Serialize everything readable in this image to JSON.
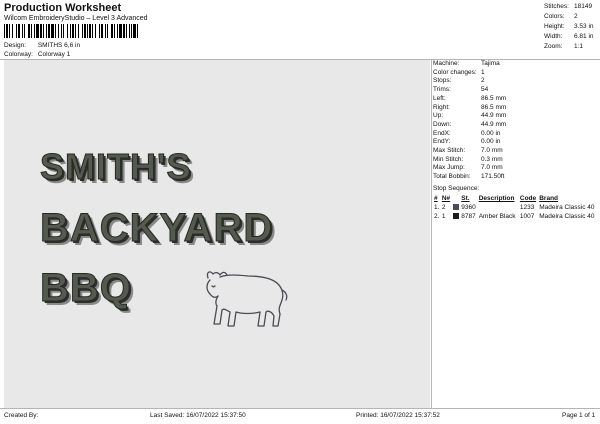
{
  "header": {
    "title": "Production Worksheet",
    "subtitle": "Wilcom EmbroideryStudio – Level 3 Advanced",
    "design_label": "Design:",
    "design_value": "SMITHS 6,6 in",
    "colorway_label": "Colorway:",
    "colorway_value": "Colorway 1"
  },
  "summary": [
    {
      "label": "Stitches:",
      "value": "18149"
    },
    {
      "label": "Colors:",
      "value": "2"
    },
    {
      "label": "Height:",
      "value": "3.53 in"
    },
    {
      "label": "Width:",
      "value": "6.81 in"
    },
    {
      "label": "Zoom:",
      "value": "1:1"
    }
  ],
  "design": {
    "line1": "SMITH'S",
    "line2": "BACKYARD",
    "line3": "BBQ",
    "thread_color": "#555a50",
    "outline_color": "#2d2f2b",
    "shadow_color": "#8a8a8a",
    "icon": "bull-icon"
  },
  "details": [
    {
      "label": "Machine:",
      "value": "Tajima"
    },
    {
      "label": "Color changes:",
      "value": "1"
    },
    {
      "label": "Stops:",
      "value": "2"
    },
    {
      "label": "Trims:",
      "value": "54"
    },
    {
      "label": "Left:",
      "value": "86.5 mm"
    },
    {
      "label": "Right:",
      "value": "86.5 mm"
    },
    {
      "label": "Up:",
      "value": "44.9 mm"
    },
    {
      "label": "Down:",
      "value": "44.9 mm"
    },
    {
      "label": "EndX:",
      "value": "0.00 in"
    },
    {
      "label": "EndY:",
      "value": "0.00 in"
    },
    {
      "label": "Max Stitch:",
      "value": "7.0 mm"
    },
    {
      "label": "Min Stitch:",
      "value": "0.3 mm"
    },
    {
      "label": "Max Jump:",
      "value": "7.0 mm"
    },
    {
      "label": "Total Bobbin:",
      "value": "171.50ft"
    }
  ],
  "stop_sequence": {
    "title": "Stop Sequence:",
    "columns": [
      "#",
      "N#",
      "St.",
      "Description",
      "Code",
      "Brand"
    ],
    "rows": [
      {
        "num": "1.",
        "n": "2",
        "color": "#4a4c55",
        "st": "9360",
        "description": "",
        "code": "1233",
        "brand": "Madeira Classic 40"
      },
      {
        "num": "2.",
        "n": "1",
        "color": "#1c1c1c",
        "st": "8787",
        "description": "Amber Black",
        "code": "1007",
        "brand": "Madeira Classic 40"
      }
    ]
  },
  "footer": {
    "created_by": "Created By:",
    "last_saved": "Last Saved: 16/07/2022 15:37:50",
    "printed": "Printed: 16/07/2022 15:37:52",
    "page": "Page 1 of 1"
  }
}
